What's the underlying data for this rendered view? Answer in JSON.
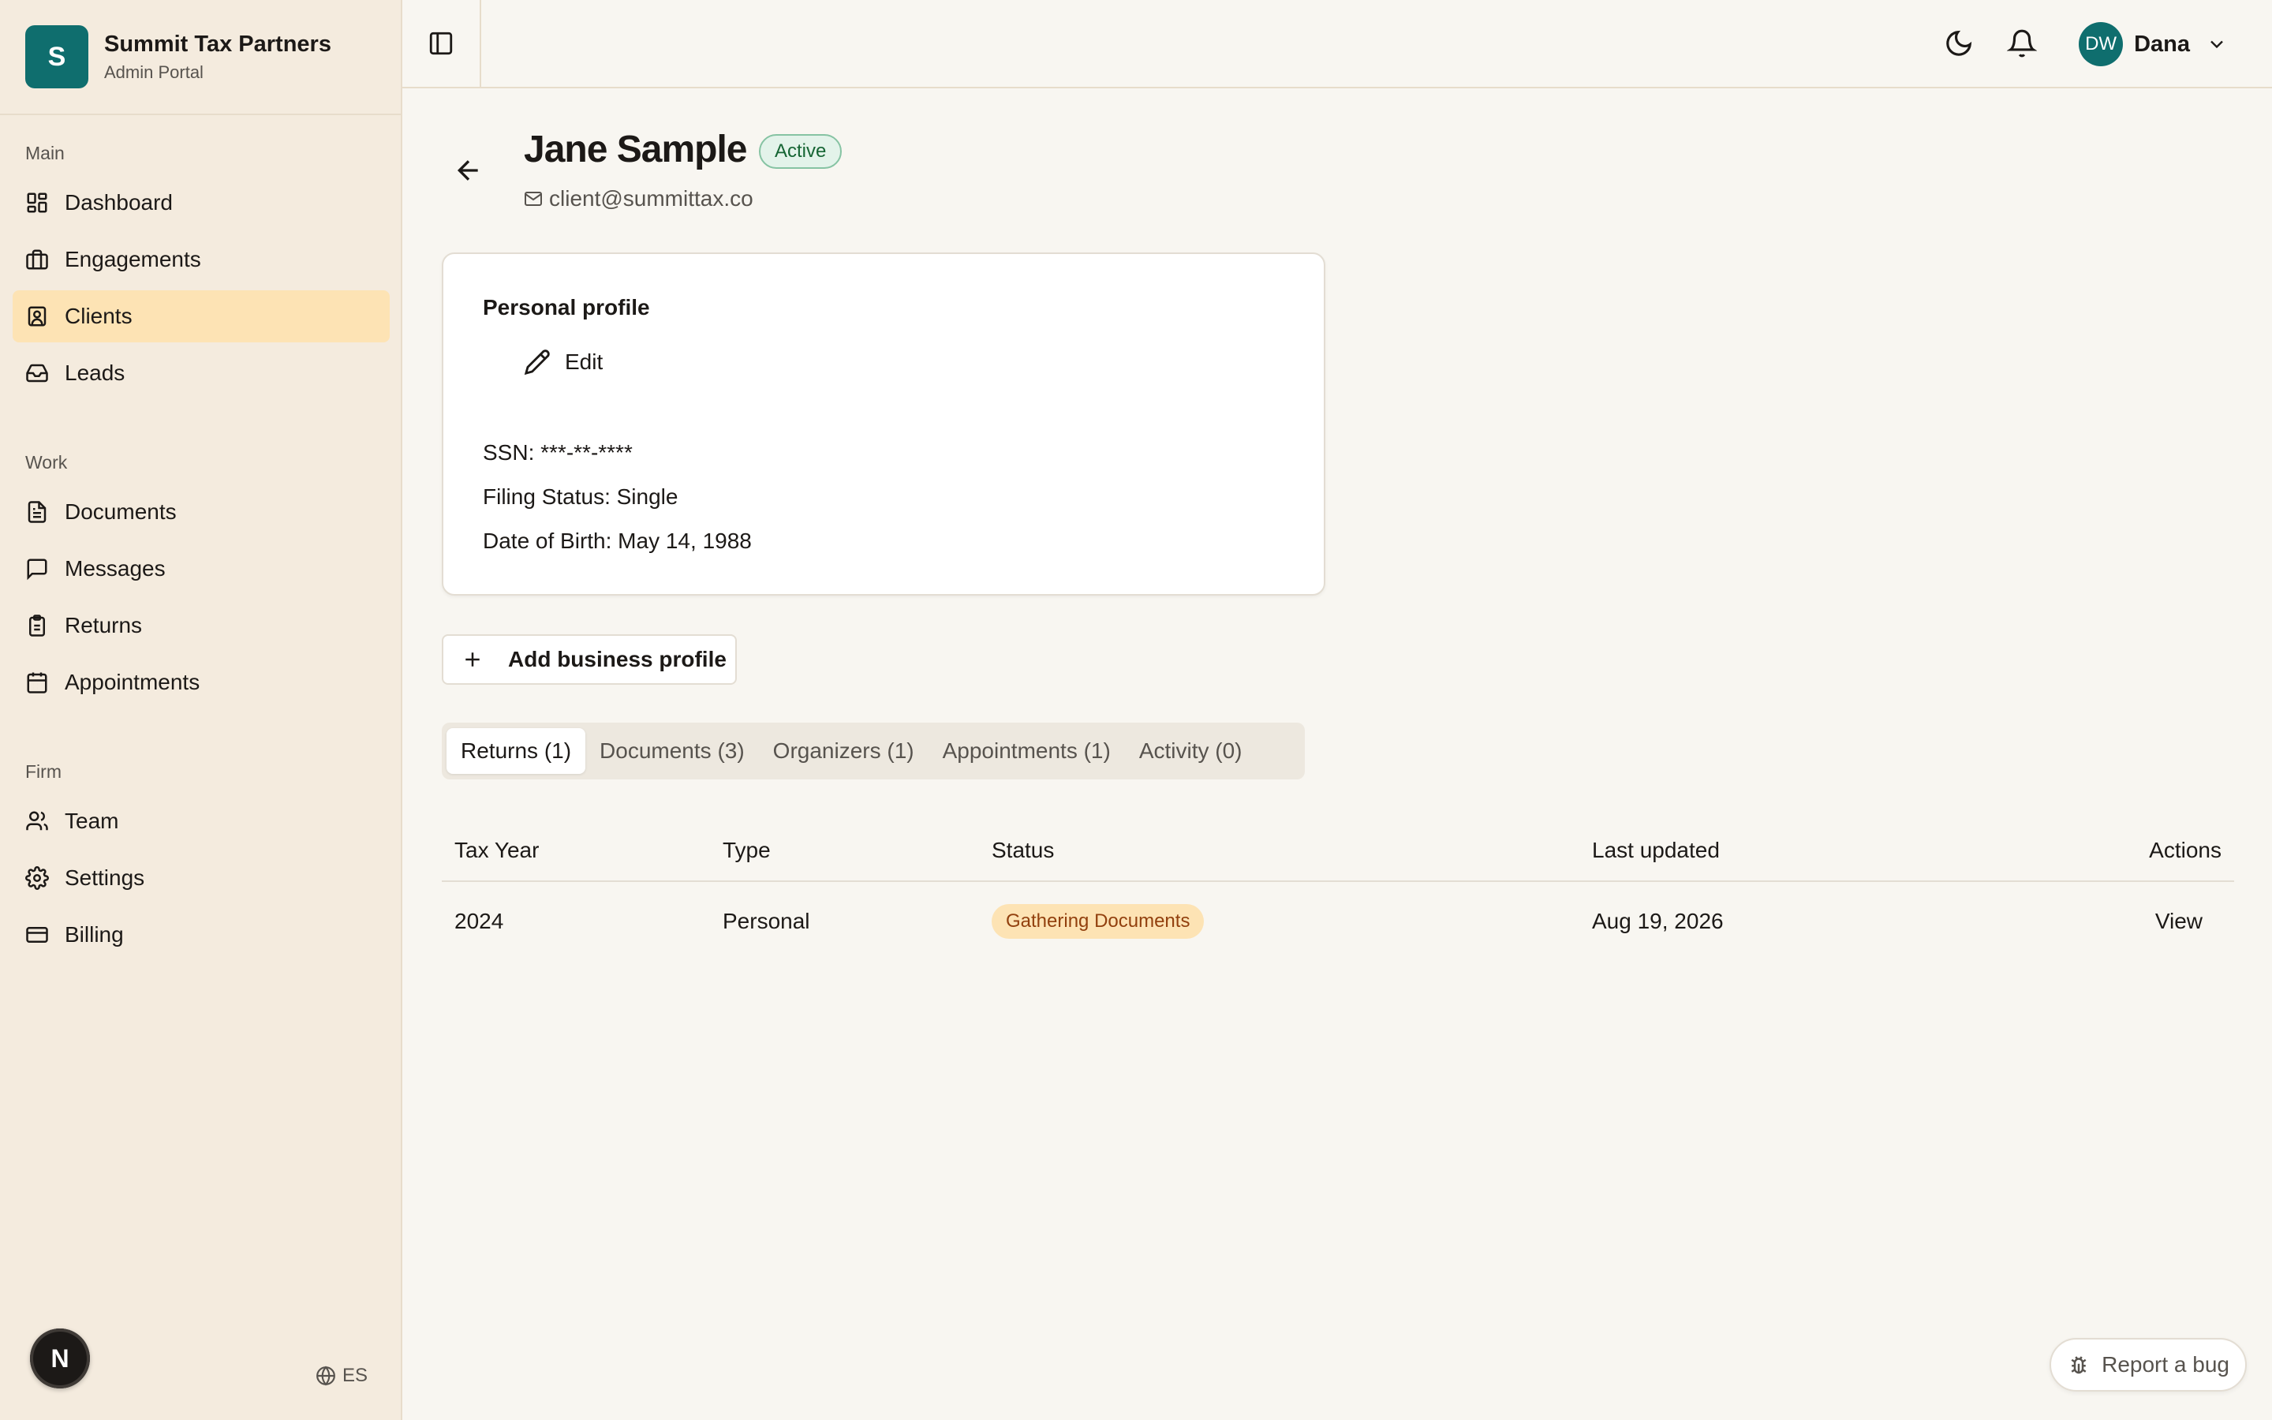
{
  "brand": {
    "logo_letter": "S",
    "name": "Summit Tax Partners",
    "subtitle": "Admin Portal",
    "color": "#0f6e6e"
  },
  "sidebar": {
    "sections": [
      {
        "heading": "Main",
        "items": [
          {
            "label": "Dashboard",
            "icon": "dashboard-icon"
          },
          {
            "label": "Engagements",
            "icon": "briefcase-icon"
          },
          {
            "label": "Clients",
            "icon": "contact-icon",
            "active": true
          },
          {
            "label": "Leads",
            "icon": "inbox-icon"
          }
        ]
      },
      {
        "heading": "Work",
        "items": [
          {
            "label": "Documents",
            "icon": "document-icon"
          },
          {
            "label": "Messages",
            "icon": "message-icon"
          },
          {
            "label": "Returns",
            "icon": "clipboard-icon"
          },
          {
            "label": "Appointments",
            "icon": "calendar-icon"
          }
        ]
      },
      {
        "heading": "Firm",
        "items": [
          {
            "label": "Team",
            "icon": "users-icon"
          },
          {
            "label": "Settings",
            "icon": "gear-icon"
          },
          {
            "label": "Billing",
            "icon": "credit-card-icon"
          }
        ]
      }
    ],
    "footer_avatar": "N",
    "language": "ES"
  },
  "topbar": {
    "user_initials": "DW",
    "user_name": "Dana"
  },
  "client": {
    "name": "Jane Sample",
    "status": "Active",
    "email": "client@summittax.co"
  },
  "profile": {
    "title": "Personal profile",
    "edit_label": "Edit",
    "ssn": "SSN: ***-**-****",
    "filing_status": "Filing Status: Single",
    "dob": "Date of Birth: May 14, 1988"
  },
  "add_business_label": "Add business profile",
  "tabs": [
    {
      "label": "Returns (1)",
      "active": true
    },
    {
      "label": "Documents (3)"
    },
    {
      "label": "Organizers (1)"
    },
    {
      "label": "Appointments (1)"
    },
    {
      "label": "Activity (0)"
    }
  ],
  "returns_table": {
    "headers": {
      "tax_year": "Tax Year",
      "type": "Type",
      "status": "Status",
      "last_updated": "Last updated",
      "actions": "Actions"
    },
    "rows": [
      {
        "tax_year": "2024",
        "type": "Personal",
        "status": "Gathering Documents",
        "last_updated": "Aug 19, 2026",
        "action": "View"
      }
    ]
  },
  "report_bug_label": "Report a bug"
}
